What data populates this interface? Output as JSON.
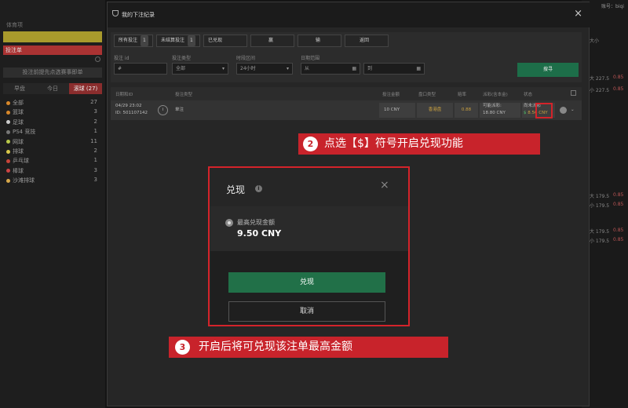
{
  "left_panel": {
    "header": "体育项",
    "red_tab": "投注单",
    "promo_btn": "投注前提先点选赛事即单",
    "tabs": [
      {
        "label": "早盘",
        "active": false
      },
      {
        "label": "今日",
        "active": false
      },
      {
        "label": "滚球 (27)",
        "active": true
      }
    ],
    "sports": [
      {
        "name": "全部",
        "count": "27",
        "color": "#d8882a"
      },
      {
        "name": "篮球",
        "count": "3",
        "color": "#d8882a"
      },
      {
        "name": "足球",
        "count": "2",
        "color": "#cccccc"
      },
      {
        "name": "PS4 竞技",
        "count": "1",
        "color": "#777777"
      },
      {
        "name": "网球",
        "count": "11",
        "color": "#b9c94a"
      },
      {
        "name": "排球",
        "count": "2",
        "color": "#d8c84a"
      },
      {
        "name": "乒乓球",
        "count": "1",
        "color": "#c8443a"
      },
      {
        "name": "棒球",
        "count": "3",
        "color": "#cc4444"
      },
      {
        "name": "沙滩排球",
        "count": "3",
        "color": "#d8a84a"
      }
    ]
  },
  "right_panel": {
    "account": "账号：biqi",
    "header": "大小",
    "rows": [
      {
        "label": "大 227.5",
        "val": "0.85"
      },
      {
        "label": "小 227.5",
        "val": "0.85"
      },
      {
        "label": "大 179.5",
        "val": "0.85"
      },
      {
        "label": "小 179.5",
        "val": "0.85"
      },
      {
        "label": "大 179.5",
        "val": "0.85"
      },
      {
        "label": "小 179.5",
        "val": "0.85"
      }
    ]
  },
  "bet_history": {
    "title": "我的下注纪录",
    "close": "×",
    "tabs": [
      {
        "label": "所有投注",
        "count": "1"
      },
      {
        "label": "未结算投注",
        "count": "1"
      },
      {
        "label": "已兑现",
        "count": ""
      },
      {
        "label": "赢",
        "count": ""
      },
      {
        "label": "输",
        "count": ""
      },
      {
        "label": "返回",
        "count": ""
      }
    ],
    "filters": {
      "bet_id_label": "投注 id",
      "bet_id_value": "#",
      "bet_type_label": "投注类型",
      "bet_type_value": "全部",
      "time_label": "时段区间",
      "time_value": "24小时",
      "date_label": "日期范围",
      "date_from": "从",
      "date_to": "到",
      "search": "搜寻"
    },
    "columns": [
      "日期和ID",
      "投注类型",
      "投注金额",
      "盘口类型",
      "赔率",
      "派彩(含本金)",
      "状态"
    ],
    "row": {
      "date": "04/29 23:02",
      "id": "ID: 501107142",
      "type": "单注",
      "stake": "10 CNY",
      "odds_type": "香港盘",
      "odds": "0.88",
      "payout_label": "可能派彩:",
      "payout": "18.80 CNY",
      "status": "尚未派彩",
      "cashout": "8.56 CNY"
    }
  },
  "cashout_dialog": {
    "title": "兑现",
    "close": "×",
    "option_label": "最高兑现金额",
    "option_value": "9.50 CNY",
    "confirm": "兑现",
    "cancel": "取消"
  },
  "callouts": [
    {
      "num": "2",
      "text": "点选【$】符号开启兑现功能"
    },
    {
      "num": "3",
      "text": "开启后将可兑现该注单最高金额"
    }
  ],
  "colors": {
    "green": "#217048",
    "red": "#c8232b",
    "gold": "#c9a040"
  }
}
